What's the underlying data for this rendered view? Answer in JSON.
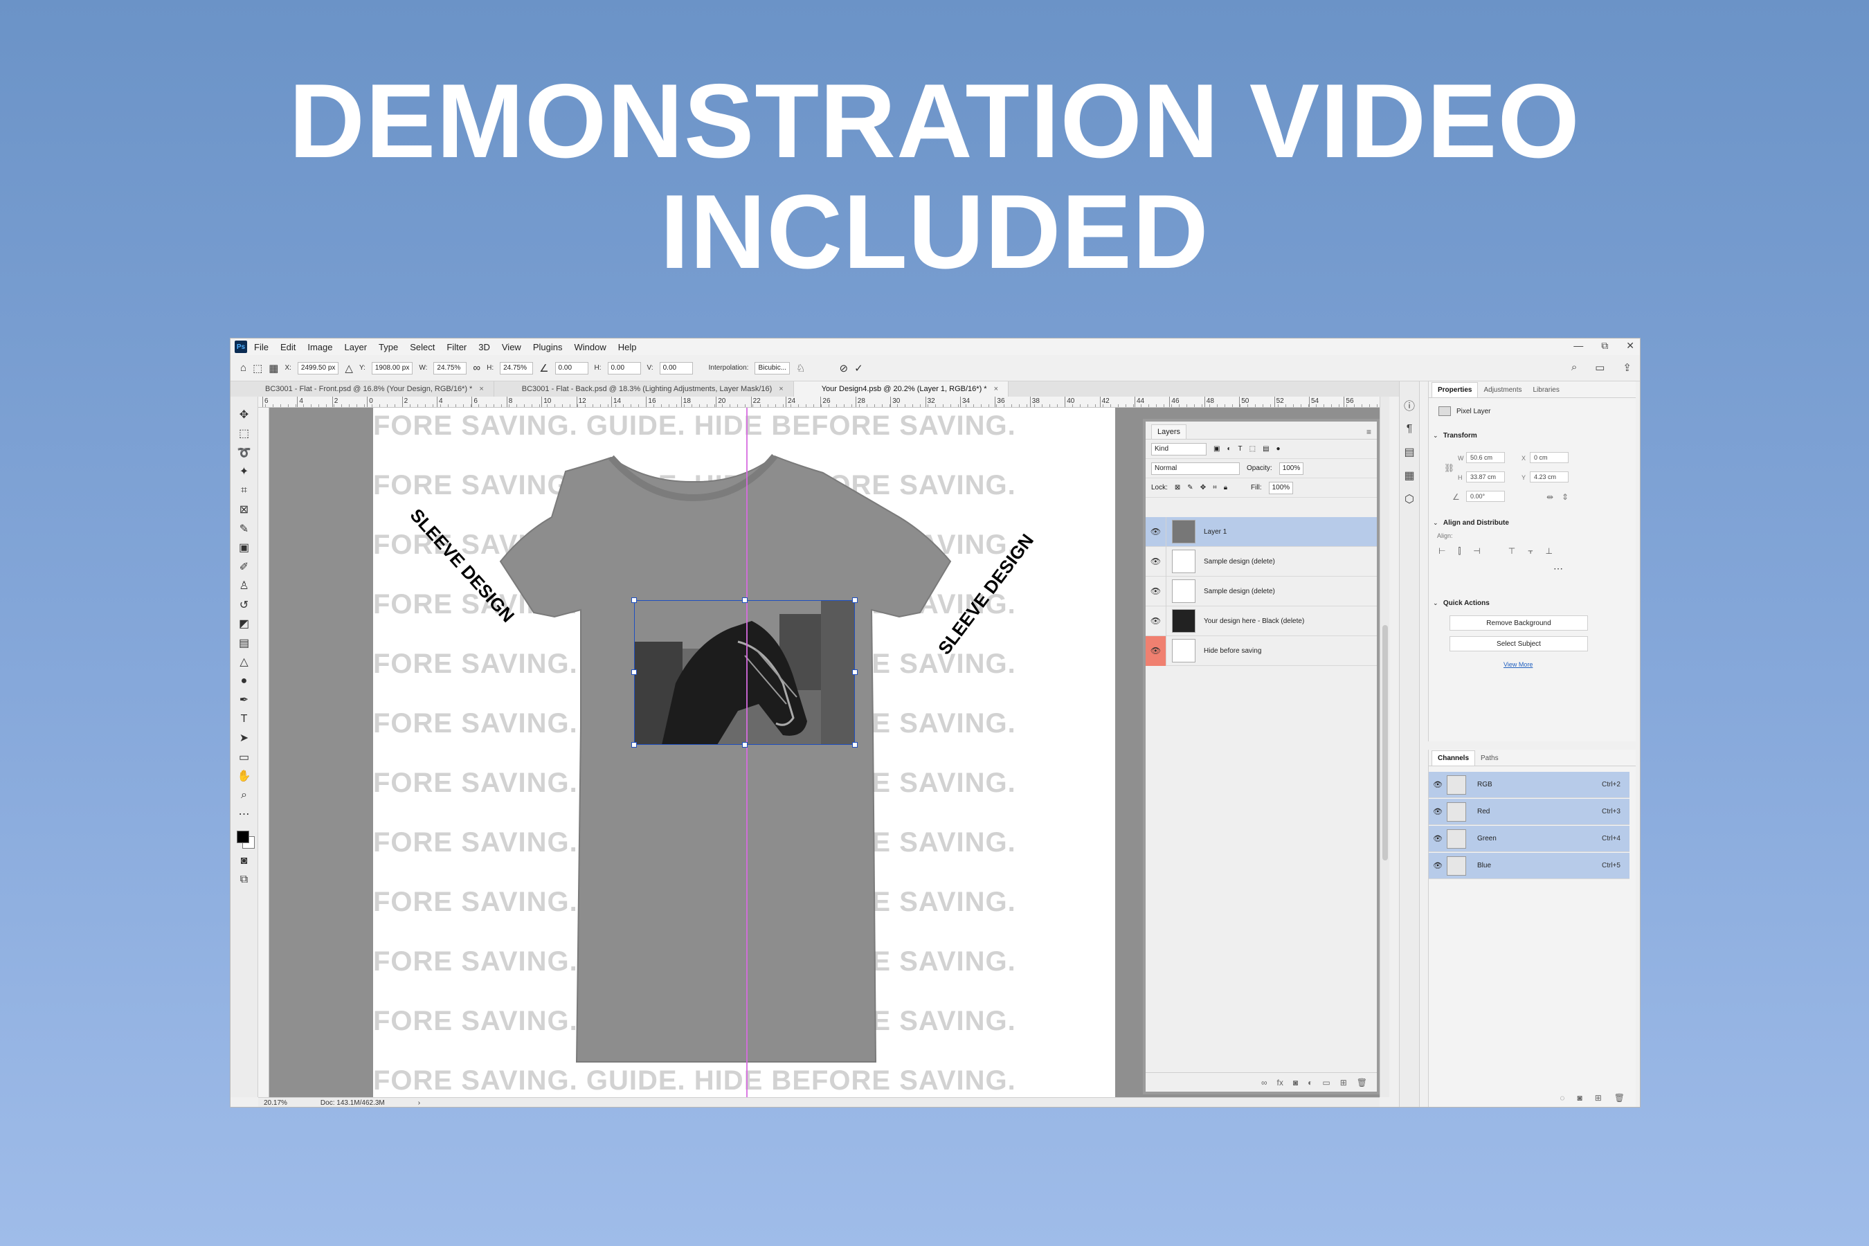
{
  "headline": {
    "line1": "DEMONSTRATION VIDEO",
    "line2": "INCLUDED"
  },
  "app": {
    "logo": "Ps",
    "menu": [
      "File",
      "Edit",
      "Image",
      "Layer",
      "Type",
      "Select",
      "Filter",
      "3D",
      "View",
      "Plugins",
      "Window",
      "Help"
    ],
    "window_controls": [
      "—",
      "⧉",
      "✕"
    ]
  },
  "options_bar": {
    "x_label": "X:",
    "x_value": "2499.50 px",
    "y_label": "Y:",
    "y_value": "1908.00 px",
    "w_label": "W:",
    "w_value": "24.75%",
    "h_label": "H:",
    "h_value": "24.75%",
    "angle_value": "0.00",
    "hskew_label": "H:",
    "hskew_value": "0.00",
    "vskew_label": "V:",
    "vskew_value": "0.00",
    "interp_label": "Interpolation:",
    "interp_value": "Bicubic...",
    "cancel_icon": "cancel-icon",
    "commit_icon": "checkmark-icon"
  },
  "tabs": [
    {
      "label": "BC3001 - Flat - Front.psd @ 16.8% (Your Design, RGB/16*) *",
      "active": false
    },
    {
      "label": "BC3001 - Flat - Back.psd @ 18.3% (Lighting Adjustments, Layer Mask/16)",
      "active": false
    },
    {
      "label": "Your Design4.psb @ 20.2% (Layer 1, RGB/16*) *",
      "active": true
    }
  ],
  "ruler_ticks": [
    "6",
    "4",
    "2",
    "0",
    "2",
    "4",
    "6",
    "8",
    "10",
    "12",
    "14",
    "16",
    "18",
    "20",
    "22",
    "24",
    "26",
    "28",
    "30",
    "32",
    "34",
    "36",
    "38",
    "40",
    "42",
    "44",
    "46",
    "48",
    "50",
    "52",
    "54",
    "56"
  ],
  "canvas": {
    "watermark_rows": [
      "FORE SAVING. GUIDE. HIDE BEFORE SAVING.",
      "FORE SAVING. GUIDE. HIDE BEFORE SAVING.",
      "FORE SAVING. GUIDE. HIDE BEFORE SAVING.",
      "FORE SAVING. GUIDE. HIDE BEFORE SAVING.",
      "FORE SAVING. GUIDE. HIDE BEFORE SAVING.",
      "FORE SAVING. GUIDE. HIDE BEFORE SAVING.",
      "FORE SAVING. GUIDE. HIDE BEFORE SAVING.",
      "FORE SAVING. GUIDE. HIDE BEFORE SAVING.",
      "FORE SAVING. GUIDE. HIDE BEFORE SAVING.",
      "FORE SAVING. GUIDE. HIDE BEFORE SAVING.",
      "FORE SAVING. GUIDE. HIDE BEFORE SAVING.",
      "FORE SAVING. GUIDE. HIDE BEFORE SAVING."
    ],
    "sleeve_left": "SLEEVE DESIGN",
    "sleeve_right": "SLEEVE DESIGN",
    "shirt_color": "#8d8d8d"
  },
  "status": {
    "zoom": "20.17%",
    "doc": "Doc: 143.1M/462.3M"
  },
  "layers_panel": {
    "title": "Layers",
    "kind_placeholder": "Kind",
    "blend_mode": "Normal",
    "opacity_label": "Opacity:",
    "opacity_value": "100%",
    "lock_label": "Lock:",
    "fill_label": "Fill:",
    "fill_value": "100%",
    "layers": [
      {
        "name": "Layer 1",
        "selected": true
      },
      {
        "name": "Sample design (delete)",
        "selected": false
      },
      {
        "name": "Sample design (delete)",
        "selected": false
      },
      {
        "name": "Your design here - Black (delete)",
        "selected": false
      },
      {
        "name": "Hide before saving",
        "selected": false
      }
    ]
  },
  "properties_panel": {
    "tabs": [
      "Properties",
      "Adjustments",
      "Libraries"
    ],
    "layer_type": "Pixel Layer",
    "transform_title": "Transform",
    "w_label": "W",
    "w_value": "50.6 cm",
    "x_label": "X",
    "x_value": "0 cm",
    "h_label": "H",
    "h_value": "33.87 cm",
    "y_label": "Y",
    "y_value": "4.23 cm",
    "angle_value": "0.00°",
    "align_title": "Align and Distribute",
    "align_label": "Align:",
    "quick_title": "Quick Actions",
    "remove_bg": "Remove Background",
    "select_subject": "Select Subject",
    "view_more": "View More"
  },
  "channels_panel": {
    "tabs": [
      "Channels",
      "Paths"
    ],
    "channels": [
      {
        "name": "RGB",
        "key": "Ctrl+2"
      },
      {
        "name": "Red",
        "key": "Ctrl+3"
      },
      {
        "name": "Green",
        "key": "Ctrl+4"
      },
      {
        "name": "Blue",
        "key": "Ctrl+5"
      }
    ]
  }
}
